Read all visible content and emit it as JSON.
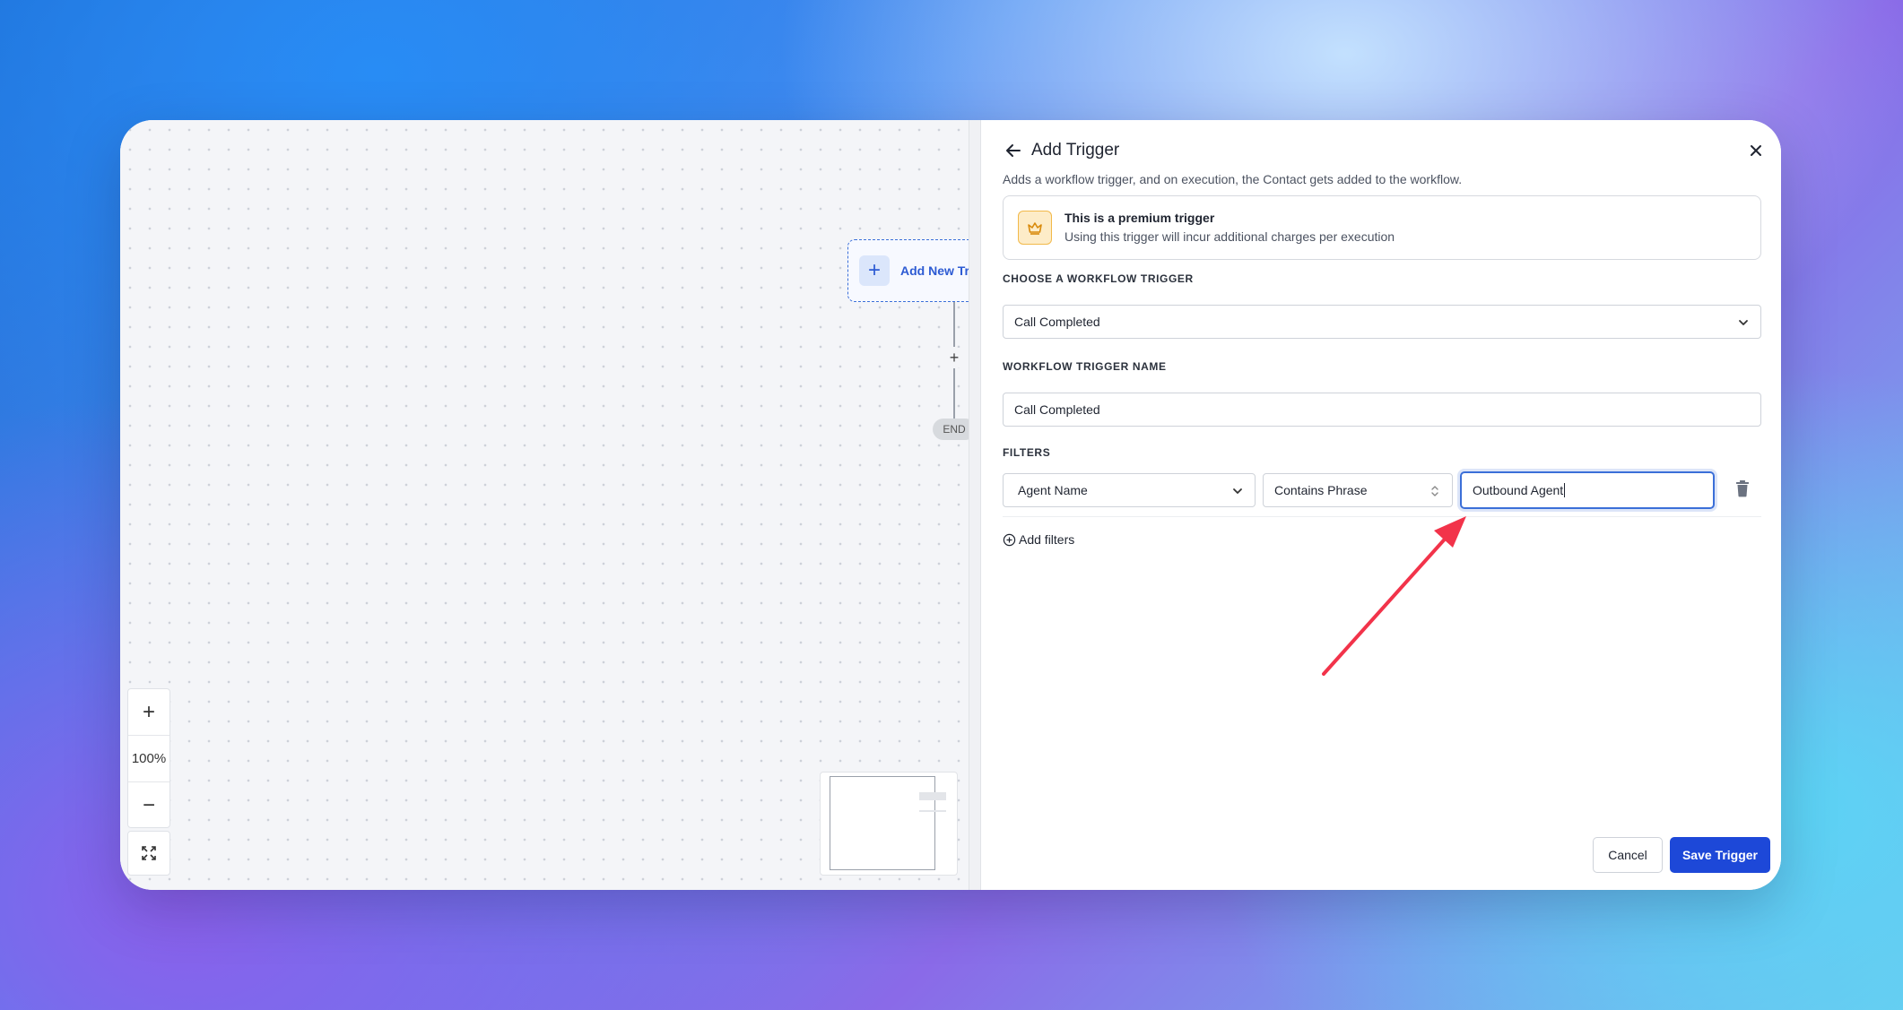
{
  "canvas": {
    "add_trigger_label": "Add New Trig",
    "end_label": "END",
    "zoom_in_icon": "+",
    "zoom_level": "100%",
    "zoom_out_icon": "−",
    "connector_plus": "+"
  },
  "panel": {
    "title": "Add Trigger",
    "description": "Adds a workflow trigger, and on execution, the Contact gets added to the workflow.",
    "premium": {
      "title": "This is a premium trigger",
      "subtitle": "Using this trigger will incur additional charges per execution"
    },
    "choose_label": "CHOOSE A WORKFLOW TRIGGER",
    "trigger_select_value": "Call Completed",
    "name_label": "WORKFLOW TRIGGER NAME",
    "name_value": "Call Completed",
    "filters_label": "FILTERS",
    "filter": {
      "field": "Agent Name",
      "operator": "Contains Phrase",
      "value": "Outbound Agent"
    },
    "add_filters_label": "Add filters",
    "cancel_label": "Cancel",
    "save_label": "Save Trigger"
  },
  "colors": {
    "accent": "#1d48d8",
    "annotation_arrow": "#f2334a",
    "premium_bg": "#fdecc8"
  }
}
